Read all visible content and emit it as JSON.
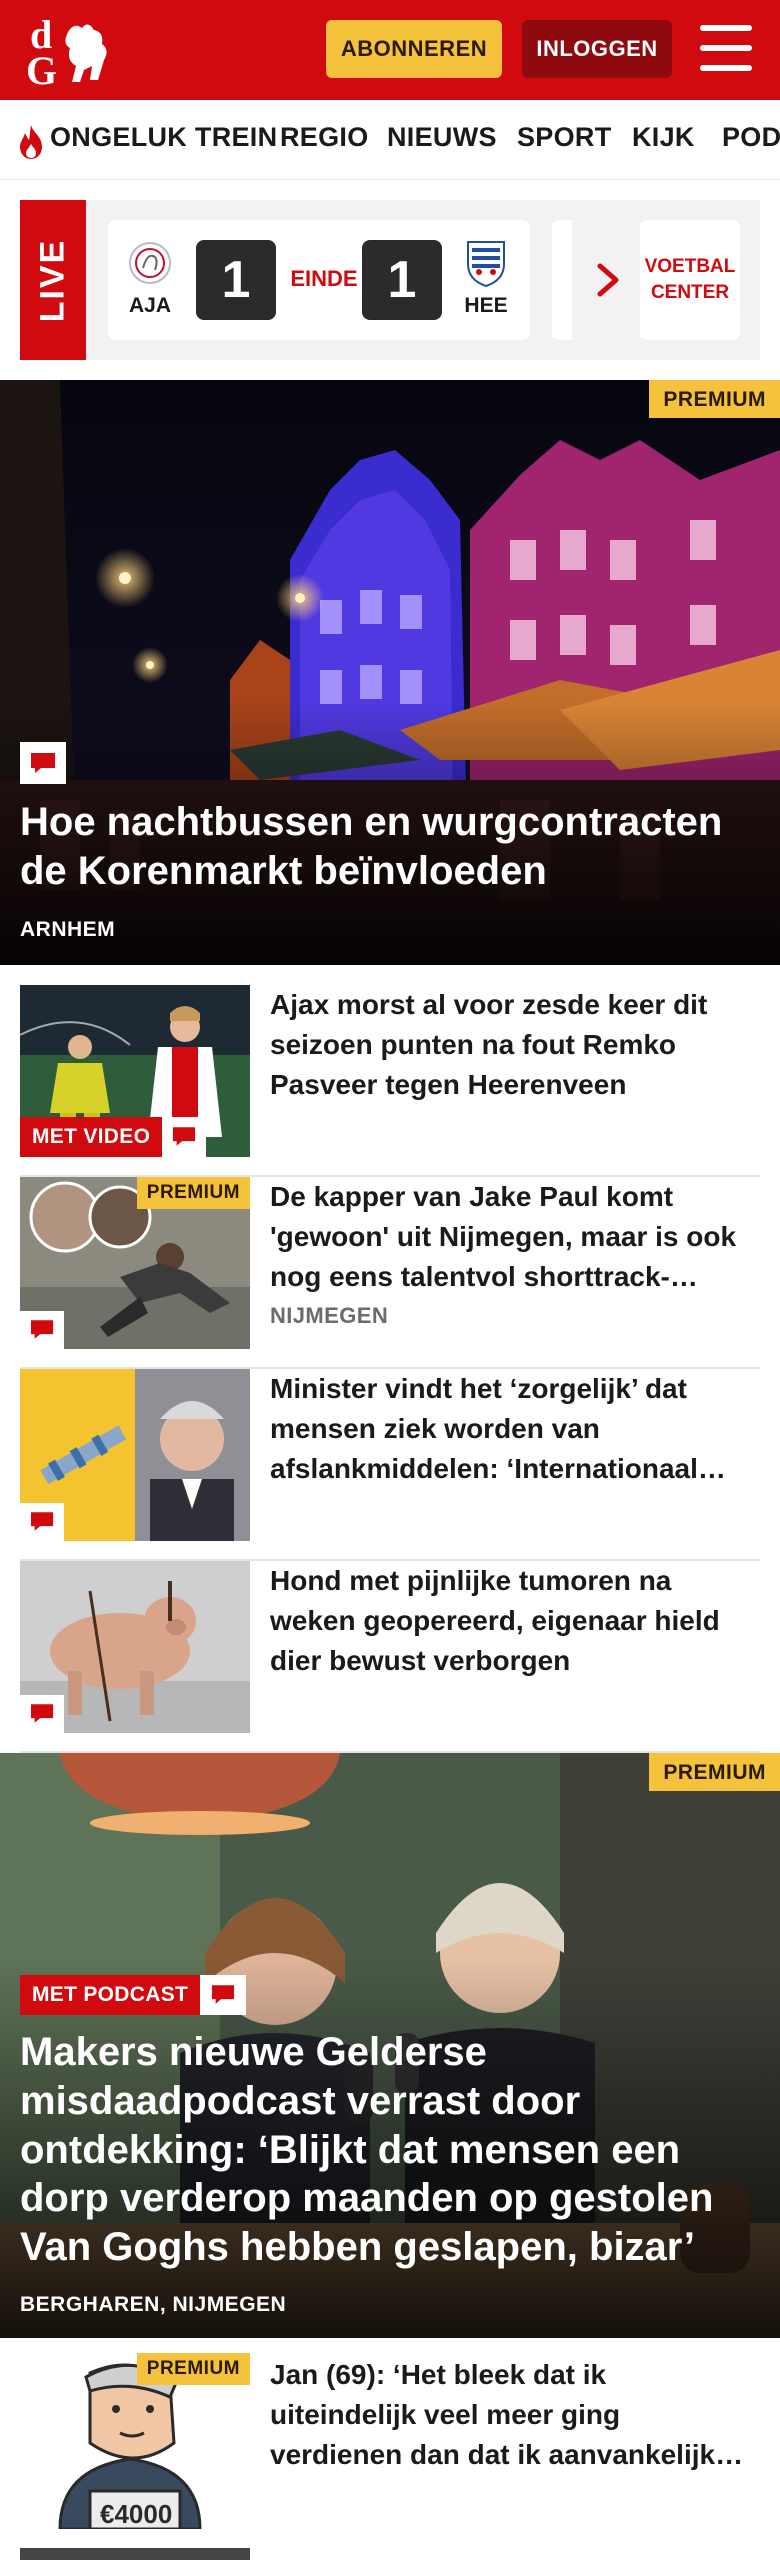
{
  "header": {
    "logo_text": "dG",
    "subscribe_label": "ABONNEREN",
    "login_label": "INLOGGEN",
    "brand_color": "#d10a10",
    "accent_color": "#f5c33b"
  },
  "nav": {
    "items": [
      "ONGELUK TREIN",
      "REGIO",
      "NIEUWS",
      "SPORT",
      "KIJK",
      "PODCAST"
    ]
  },
  "live": {
    "label": "LIVE",
    "home_team": "AJA",
    "home_score": "1",
    "status": "EINDE",
    "away_score": "1",
    "away_team": "HEE",
    "center_line1": "VOETBAL",
    "center_line2": "CENTER"
  },
  "hero1": {
    "badge": "PREMIUM",
    "title": "Hoe nachtbussen en wurgcontracten de Korenmarkt beïnvloeden",
    "location": "ARNHEM"
  },
  "articles": [
    {
      "title": "Ajax morst al voor zesde keer dit seizoen punten na fout Remko Pasveer tegen Heerenveen",
      "tag": "MET VIDEO",
      "location": ""
    },
    {
      "title": "De kapper van Jake Paul komt 'gewoon' uit Nijmegen, maar is ook nog eens talentvol shorttrack-schaatser",
      "badge": "PREMIUM",
      "location": "NIJMEGEN"
    },
    {
      "title": "Minister vindt het ‘zorgelijk’ dat mensen ziek worden van afslankmiddelen: ‘Internationaal probleem’",
      "location": ""
    },
    {
      "title": "Hond met pijnlijke tumoren na weken geopereerd, eigenaar hield dier bewust verborgen",
      "location": ""
    }
  ],
  "hero2": {
    "badge": "PREMIUM",
    "tag": "MET PODCAST",
    "title": "Makers nieuwe Gelderse misdaadpodcast verrast door ontdekking: ‘Blijkt dat mensen een dorp verderop maanden op gestolen Van Goghs hebben geslapen, bizar’",
    "location": "BERGHAREN, NIJMEGEN"
  },
  "bottom_article": {
    "badge": "PREMIUM",
    "title": "Jan (69): ‘Het bleek dat ik uiteindelijk veel meer ging verdienen dan dat ik aanvankelijk dacht’",
    "price_text": "€4000"
  }
}
